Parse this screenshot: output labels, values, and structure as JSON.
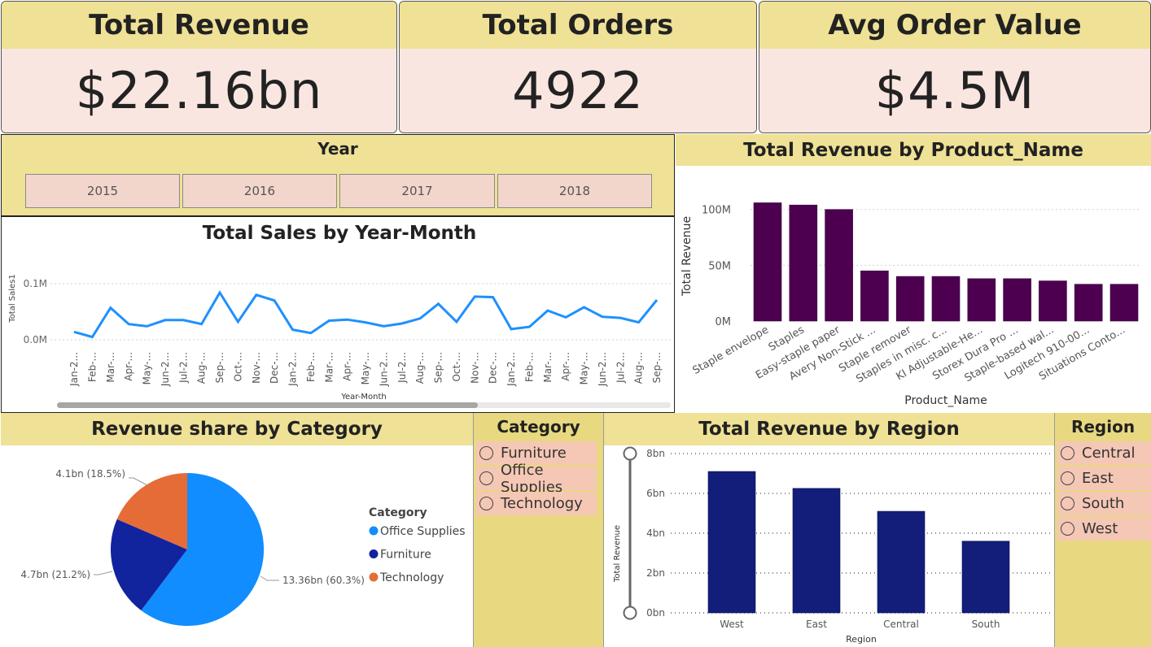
{
  "kpis": {
    "revenue": {
      "title": "Total Revenue",
      "value": "$22.16bn"
    },
    "orders": {
      "title": "Total Orders",
      "value": "4922"
    },
    "aov": {
      "title": "Avg Order Value",
      "value": "$4.5M"
    }
  },
  "year_slicer": {
    "title": "Year",
    "options": [
      "2015",
      "2016",
      "2017",
      "2018"
    ]
  },
  "category_slicer": {
    "title": "Category",
    "options": [
      "Furniture",
      "Office Supplies",
      "Technology"
    ]
  },
  "region_slicer": {
    "title": "Region",
    "options": [
      "Central",
      "East",
      "South",
      "West"
    ]
  },
  "colors": {
    "yellow": "#efe196",
    "pink": "#fae6e1",
    "line": "#1e90ff",
    "purple": "#4d0050",
    "navy": "#131d7a",
    "office": "#118dff",
    "furniture": "#12239e",
    "technology": "#e66c37"
  },
  "chart_data": [
    {
      "type": "line",
      "title": "Total Sales by Year-Month",
      "xlabel": "Year-Month",
      "ylabel": "Total Sales1",
      "yticks": [
        "0.0M",
        "0.1M"
      ],
      "ylim": [
        0,
        0.1
      ],
      "categories": [
        "Jan-2...",
        "Feb-...",
        "Mar-...",
        "Apr-...",
        "May-...",
        "Jun-2...",
        "Jul-2...",
        "Aug-...",
        "Sep-...",
        "Oct-...",
        "Nov-...",
        "Dec-...",
        "Jan-2...",
        "Feb-...",
        "Mar-...",
        "Apr-...",
        "May-...",
        "Jun-2...",
        "Jul-2...",
        "Aug-...",
        "Sep-...",
        "Oct-...",
        "Nov-...",
        "Dec-...",
        "Jan-2...",
        "Feb-...",
        "Mar-...",
        "Apr-...",
        "May-...",
        "Jun-2...",
        "Jul-2...",
        "Aug-...",
        "Sep-..."
      ],
      "values": [
        0.014,
        0.005,
        0.057,
        0.028,
        0.024,
        0.035,
        0.035,
        0.028,
        0.084,
        0.032,
        0.08,
        0.07,
        0.018,
        0.012,
        0.034,
        0.036,
        0.031,
        0.024,
        0.029,
        0.038,
        0.064,
        0.032,
        0.077,
        0.076,
        0.019,
        0.023,
        0.052,
        0.04,
        0.058,
        0.041,
        0.039,
        0.031,
        0.071
      ]
    },
    {
      "type": "bar",
      "title": "Total Revenue by Product_Name",
      "xlabel": "Product_Name",
      "ylabel": "Total Revenue",
      "yticks": [
        "0M",
        "50M",
        "100M"
      ],
      "ylim": [
        0,
        110
      ],
      "categories": [
        "Staple envelope",
        "Staples",
        "Easy-staple paper",
        "Avery Non-Stick ...",
        "Staple remover",
        "Staples in misc. c...",
        "KI Adjustable-He...",
        "Storex Dura Pro ...",
        "Staple-based wal...",
        "Logitech 910-00...",
        "Situations Conto..."
      ],
      "values": [
        106,
        104,
        100,
        45,
        40,
        40,
        38,
        38,
        36,
        33,
        33
      ]
    },
    {
      "type": "pie",
      "title": "Revenue share by Category",
      "legend_title": "Category",
      "legend": [
        "Office Supplies",
        "Furniture",
        "Technology"
      ],
      "values": [
        13.36,
        4.7,
        4.1
      ],
      "labels": [
        "13.36bn (60.3%)",
        "4.7bn (21.2%)",
        "4.1bn (18.5%)"
      ]
    },
    {
      "type": "bar",
      "title": "Total Revenue by Region",
      "xlabel": "Region",
      "ylabel": "Total Revenue",
      "yticks": [
        "0bn",
        "2bn",
        "4bn",
        "6bn",
        "8bn"
      ],
      "ylim": [
        0,
        8
      ],
      "categories": [
        "West",
        "East",
        "Central",
        "South"
      ],
      "values": [
        7.1,
        6.25,
        5.1,
        3.6
      ]
    }
  ]
}
